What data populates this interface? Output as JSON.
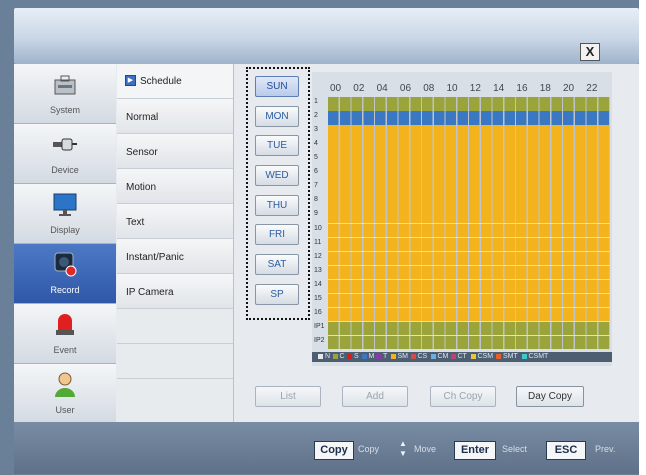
{
  "nav": [
    {
      "label": "System",
      "icon": "toolbox-icon"
    },
    {
      "label": "Device",
      "icon": "plug-icon"
    },
    {
      "label": "Display",
      "icon": "monitor-icon"
    },
    {
      "label": "Record",
      "icon": "camera-record-icon",
      "active": true
    },
    {
      "label": "Event",
      "icon": "alarm-light-icon"
    },
    {
      "label": "User",
      "icon": "user-icon"
    }
  ],
  "submenu": [
    "Schedule",
    "Normal",
    "Sensor",
    "Motion",
    "Text",
    "Instant/Panic",
    "IP Camera"
  ],
  "days": [
    "SUN",
    "MON",
    "TUE",
    "WED",
    "THU",
    "FRI",
    "SAT",
    "SP"
  ],
  "hours": [
    "00",
    "02",
    "04",
    "06",
    "08",
    "10",
    "12",
    "14",
    "16",
    "18",
    "20",
    "22"
  ],
  "row_labels": [
    "1",
    "2",
    "3",
    "4",
    "5",
    "6",
    "7",
    "8",
    "9",
    "10",
    "11",
    "12",
    "13",
    "14",
    "15",
    "16",
    "IP1",
    "IP2"
  ],
  "row_modes": [
    "olive",
    "blue",
    "orange",
    "orange",
    "orange",
    "orange",
    "orange",
    "orange",
    "orange",
    "orange",
    "orange",
    "orange",
    "orange",
    "orange",
    "orange",
    "orange",
    "olive",
    "olive"
  ],
  "colors": {
    "olive": "#9aa43a",
    "blue": "#3b78c4",
    "orange": "#f3b31c",
    "active_nav": "#2f58a8"
  },
  "legend": [
    {
      "code": "N",
      "color": "#e6e8ea"
    },
    {
      "code": "C",
      "color": "#9aa43a"
    },
    {
      "code": "S",
      "color": "#cc2222"
    },
    {
      "code": "M",
      "color": "#3b78c4"
    },
    {
      "code": "T",
      "color": "#8a3aa8"
    },
    {
      "code": "SM",
      "color": "#f3b31c"
    },
    {
      "code": "CS",
      "color": "#d84a4a"
    },
    {
      "code": "CM",
      "color": "#6ab0e0"
    },
    {
      "code": "CT",
      "color": "#c04070"
    },
    {
      "code": "CSM",
      "color": "#e8c83a"
    },
    {
      "code": "SMT",
      "color": "#e06030"
    },
    {
      "code": "CSMT",
      "color": "#3ec8c8"
    }
  ],
  "actions": [
    "List",
    "Add",
    "Ch Copy",
    "Day Copy"
  ],
  "bottom_keys": [
    {
      "key": "Copy",
      "label": "Copy"
    },
    {
      "key": "",
      "label": "Move"
    },
    {
      "key": "Enter",
      "label": "Select"
    },
    {
      "key": "ESC",
      "label": "Prev."
    }
  ],
  "close_symbol": "X"
}
